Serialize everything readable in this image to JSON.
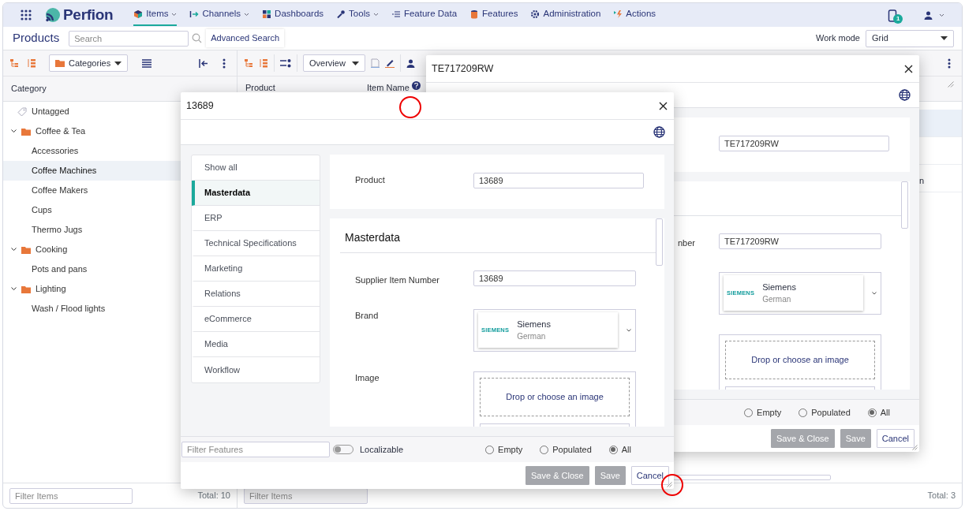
{
  "navbar": {
    "brand": "Perfion",
    "menu": [
      {
        "label": "Items",
        "kind": "items",
        "caret": true,
        "selected": true
      },
      {
        "label": "Channels",
        "kind": "channels",
        "caret": true,
        "selected": false
      },
      {
        "label": "Dashboards",
        "kind": "dashboards",
        "caret": false,
        "selected": false
      },
      {
        "label": "Tools",
        "kind": "tools",
        "caret": true,
        "selected": false
      },
      {
        "label": "Feature Data",
        "kind": "featuredata",
        "caret": false,
        "selected": false
      },
      {
        "label": "Features",
        "kind": "features",
        "caret": false,
        "selected": false
      },
      {
        "label": "Administration",
        "kind": "admin",
        "caret": false,
        "selected": false
      },
      {
        "label": "Actions",
        "kind": "actions",
        "caret": false,
        "selected": false
      }
    ],
    "notification_count": "1"
  },
  "toolbar": {
    "title": "Products",
    "search_placeholder": "Search",
    "advanced_search": "Advanced Search",
    "work_mode_label": "Work mode",
    "work_mode": "Grid"
  },
  "category_panel": {
    "view": "Categories",
    "column": "Category",
    "tree": [
      {
        "label": "Untagged",
        "kind": "tag",
        "selected": false
      },
      {
        "label": "Coffee & Tea",
        "kind": "folder",
        "expanded": true,
        "selected": false,
        "children": [
          {
            "label": "Accessories",
            "selected": false
          },
          {
            "label": "Coffee Machines",
            "selected": true
          },
          {
            "label": "Coffee Makers",
            "selected": false
          },
          {
            "label": "Cups",
            "selected": false
          },
          {
            "label": "Thermo Jugs",
            "selected": false
          }
        ]
      },
      {
        "label": "Cooking",
        "kind": "folder",
        "expanded": true,
        "selected": false,
        "children": [
          {
            "label": "Pots and pans",
            "selected": false
          }
        ]
      },
      {
        "label": "Lighting",
        "kind": "folder",
        "expanded": true,
        "selected": false,
        "children": [
          {
            "label": "Wash / Flood lights",
            "selected": false
          }
        ]
      }
    ],
    "filter_placeholder": "Filter Items",
    "total": "Total: 10"
  },
  "items_panel": {
    "view": "Overview",
    "columns": [
      "Product",
      "Item Name"
    ],
    "rows": [
      {
        "cell": "",
        "selected": true
      },
      {
        "cell": "",
        "selected": false
      },
      {
        "cell": "n",
        "selected": false
      }
    ],
    "filter_placeholder": "Filter Items",
    "total": "Total: 3"
  },
  "dialogs": [
    {
      "title": "TE717209RW",
      "product": "TE717209RW",
      "fields": [
        {
          "kind": "text",
          "label": "nber",
          "value": "TE717209RW"
        },
        {
          "kind": "brand",
          "logo": "SIEMENS",
          "name": "Siemens",
          "language": "German"
        },
        {
          "kind": "image",
          "hint": "Drop or choose an image"
        }
      ],
      "filters": [
        {
          "label": "Empty",
          "selected": false
        },
        {
          "label": "Populated",
          "selected": false
        },
        {
          "label": "All",
          "selected": true
        }
      ],
      "buttons": [
        {
          "label": "Save & Close",
          "disabled": true
        },
        {
          "label": "Save",
          "disabled": true
        },
        {
          "label": "Cancel",
          "disabled": false
        }
      ]
    },
    {
      "title": "13689",
      "sections": [
        {
          "label": "Show all",
          "selected": false
        },
        {
          "label": "Masterdata",
          "selected": true
        },
        {
          "label": "ERP",
          "selected": false
        },
        {
          "label": "Technical Specifications",
          "selected": false
        },
        {
          "label": "Marketing",
          "selected": false
        },
        {
          "label": "Relations",
          "selected": false
        },
        {
          "label": "eCommerce",
          "selected": false
        },
        {
          "label": "Media",
          "selected": false
        },
        {
          "label": "Workflow",
          "selected": false
        }
      ],
      "product_label": "Product",
      "product": "13689",
      "group_title": "Masterdata",
      "fields": [
        {
          "kind": "text",
          "label": "Supplier Item Number",
          "value": "13689"
        },
        {
          "kind": "brand",
          "label": "Brand",
          "logo": "SIEMENS",
          "name": "Siemens",
          "language": "German"
        },
        {
          "kind": "image",
          "label": "Image",
          "hint": "Drop or choose an image"
        }
      ],
      "filter_placeholder": "Filter Features",
      "localizable": {
        "label": "Localizable",
        "on": false
      },
      "filters": [
        {
          "label": "Empty",
          "selected": false
        },
        {
          "label": "Populated",
          "selected": false
        },
        {
          "label": "All",
          "selected": true
        }
      ],
      "buttons": [
        {
          "label": "Save & Close",
          "disabled": true
        },
        {
          "label": "Save",
          "disabled": true
        },
        {
          "label": "Cancel",
          "disabled": false
        }
      ]
    }
  ]
}
